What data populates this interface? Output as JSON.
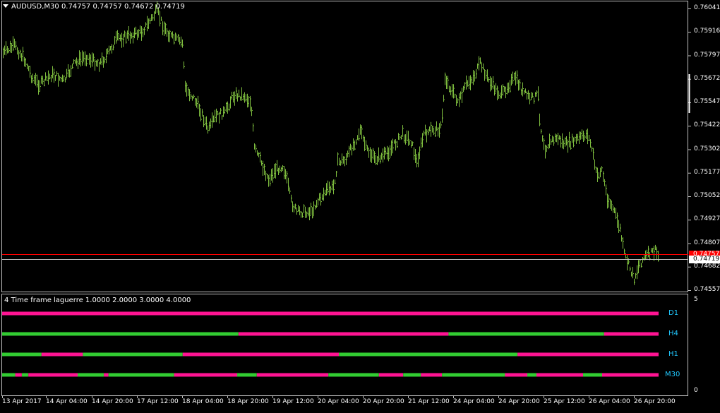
{
  "chart": {
    "symbol_header": "AUDUSD,M30  0.74757 0.74757 0.74672 0.74719",
    "bar_color": "#7fbf3f",
    "bid_line_color": "#c0c0c0",
    "ask_line_color": "#ff0000",
    "price_axis": [
      "0.76041",
      "0.75916",
      "0.75797",
      "0.75672",
      "0.75547",
      "0.75422",
      "0.75302",
      "0.75177",
      "0.75052",
      "0.74927",
      "0.74807",
      "0.74682",
      "0.74557"
    ],
    "ask_tag": "0.74757",
    "bid_tag": "0.74719",
    "time_axis": [
      "13 Apr 2017",
      "14 Apr 04:00",
      "14 Apr 20:00",
      "17 Apr 12:00",
      "18 Apr 04:00",
      "18 Apr 20:00",
      "19 Apr 12:00",
      "20 Apr 04:00",
      "20 Apr 20:00",
      "21 Apr 12:00",
      "24 Apr 04:00",
      "24 Apr 20:00",
      "25 Apr 12:00",
      "26 Apr 04:00",
      "26 Apr 20:00"
    ]
  },
  "indicator": {
    "header": "4 Time frame laguerre 1.0000 2.0000 3.0000 4.0000",
    "axis_top": "5",
    "axis_bottom": "0",
    "colors": {
      "up": "#32cd32",
      "down": "#ff1493"
    },
    "timeframes": [
      {
        "label": "D1",
        "segments": [
          {
            "state": "down",
            "len": 1.0
          }
        ]
      },
      {
        "label": "H4",
        "segments": [
          {
            "state": "up",
            "len": 0.36
          },
          {
            "state": "down",
            "len": 0.32
          },
          {
            "state": "up",
            "len": 0.237
          },
          {
            "state": "down",
            "len": 0.083
          }
        ]
      },
      {
        "label": "H1",
        "segments": [
          {
            "state": "up",
            "len": 0.06
          },
          {
            "state": "down",
            "len": 0.063
          },
          {
            "state": "up",
            "len": 0.152
          },
          {
            "state": "down",
            "len": 0.238
          },
          {
            "state": "up",
            "len": 0.272
          },
          {
            "state": "down",
            "len": 0.215
          }
        ]
      },
      {
        "label": "M30",
        "segments": [
          {
            "state": "up",
            "len": 0.02
          },
          {
            "state": "down",
            "len": 0.01
          },
          {
            "state": "up",
            "len": 0.01
          },
          {
            "state": "down",
            "len": 0.075
          },
          {
            "state": "up",
            "len": 0.04
          },
          {
            "state": "down",
            "len": 0.007
          },
          {
            "state": "up",
            "len": 0.1
          },
          {
            "state": "down",
            "len": 0.096
          },
          {
            "state": "up",
            "len": 0.03
          },
          {
            "state": "down",
            "len": 0.109
          },
          {
            "state": "up",
            "len": 0.077
          },
          {
            "state": "down",
            "len": 0.037
          },
          {
            "state": "up",
            "len": 0.027
          },
          {
            "state": "down",
            "len": 0.032
          },
          {
            "state": "up",
            "len": 0.096
          },
          {
            "state": "down",
            "len": 0.034
          },
          {
            "state": "up",
            "len": 0.014
          },
          {
            "state": "down",
            "len": 0.071
          },
          {
            "state": "up",
            "len": 0.029
          },
          {
            "state": "down",
            "len": 0.086
          }
        ]
      }
    ]
  }
}
